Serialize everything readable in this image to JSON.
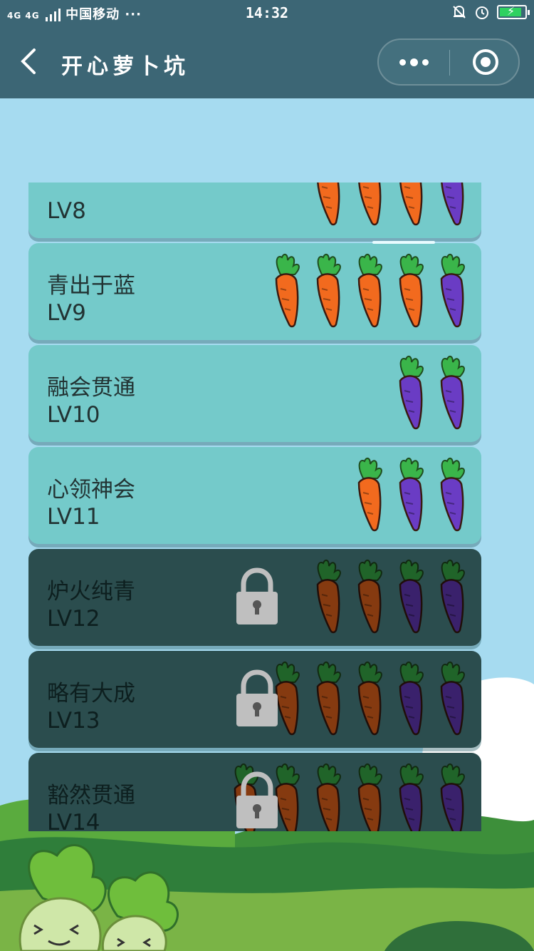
{
  "status_bar": {
    "carrier": "中国移动 ···",
    "network": "4G 4G",
    "time": "14:32"
  },
  "nav": {
    "title": "开心萝卜坑"
  },
  "colors": {
    "nav_bg": "#3c6675",
    "sky": "#a6dbf0",
    "card_unlocked": "#74caca",
    "card_locked": "#2b4d4e",
    "carrot_orange": "#f26a1e",
    "carrot_purple": "#6a3cc4",
    "leaf_green": "#3ab54a"
  },
  "levels": [
    {
      "name": "",
      "lv": "LV8",
      "locked": false,
      "carrots": [
        "purple",
        "orange",
        "orange",
        "orange"
      ]
    },
    {
      "name": "青出于蓝",
      "lv": "LV9",
      "locked": false,
      "carrots": [
        "purple",
        "orange",
        "orange",
        "orange",
        "orange"
      ]
    },
    {
      "name": "融会贯通",
      "lv": "LV10",
      "locked": false,
      "carrots": [
        "purple",
        "purple"
      ]
    },
    {
      "name": "心领神会",
      "lv": "LV11",
      "locked": false,
      "carrots": [
        "purple",
        "purple",
        "orange"
      ]
    },
    {
      "name": "炉火纯青",
      "lv": "LV12",
      "locked": true,
      "carrots": [
        "purple",
        "purple",
        "orange",
        "orange"
      ]
    },
    {
      "name": "略有大成",
      "lv": "LV13",
      "locked": true,
      "carrots": [
        "purple",
        "purple",
        "orange",
        "orange",
        "orange"
      ]
    },
    {
      "name": "豁然贯通",
      "lv": "LV14",
      "locked": true,
      "carrots": [
        "purple",
        "purple",
        "orange",
        "orange",
        "orange",
        "orange"
      ]
    }
  ]
}
